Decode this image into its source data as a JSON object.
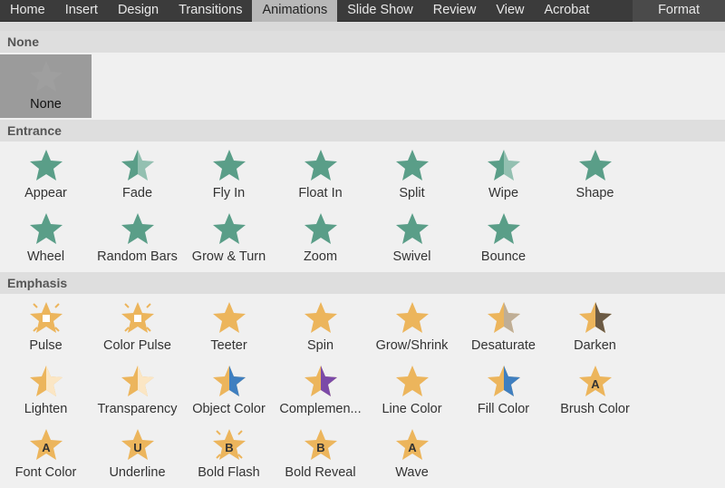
{
  "tabs": [
    "Home",
    "Insert",
    "Design",
    "Transitions",
    "Animations",
    "Slide Show",
    "Review",
    "View",
    "Acrobat",
    "Format"
  ],
  "active_tab": "Animations",
  "colors": {
    "entrance": "#5a9e88",
    "emphasis": "#ecb55c",
    "none": "#a3a3a3"
  },
  "sections": [
    {
      "title": "None",
      "kind": "none",
      "items": [
        {
          "label": "None",
          "icon": "star-outline-icon"
        }
      ]
    },
    {
      "title": "Entrance",
      "kind": "entrance",
      "items": [
        {
          "label": "Appear",
          "icon": "appear-icon"
        },
        {
          "label": "Fade",
          "icon": "fade-icon"
        },
        {
          "label": "Fly In",
          "icon": "fly-in-icon"
        },
        {
          "label": "Float In",
          "icon": "float-in-icon"
        },
        {
          "label": "Split",
          "icon": "split-icon"
        },
        {
          "label": "Wipe",
          "icon": "wipe-icon"
        },
        {
          "label": "Shape",
          "icon": "shape-icon"
        },
        {
          "label": "Wheel",
          "icon": "wheel-icon"
        },
        {
          "label": "Random Bars",
          "icon": "random-bars-icon"
        },
        {
          "label": "Grow & Turn",
          "icon": "grow-turn-icon"
        },
        {
          "label": "Zoom",
          "icon": "zoom-icon"
        },
        {
          "label": "Swivel",
          "icon": "swivel-icon"
        },
        {
          "label": "Bounce",
          "icon": "bounce-icon"
        }
      ]
    },
    {
      "title": "Emphasis",
      "kind": "emphasis",
      "items": [
        {
          "label": "Pulse",
          "icon": "pulse-icon"
        },
        {
          "label": "Color Pulse",
          "icon": "color-pulse-icon"
        },
        {
          "label": "Teeter",
          "icon": "teeter-icon"
        },
        {
          "label": "Spin",
          "icon": "spin-icon"
        },
        {
          "label": "Grow/Shrink",
          "icon": "grow-shrink-icon"
        },
        {
          "label": "Desaturate",
          "icon": "desaturate-icon"
        },
        {
          "label": "Darken",
          "icon": "darken-icon"
        },
        {
          "label": "Lighten",
          "icon": "lighten-icon"
        },
        {
          "label": "Transparency",
          "icon": "transparency-icon"
        },
        {
          "label": "Object Color",
          "icon": "object-color-icon",
          "half": "#3f7fc0"
        },
        {
          "label": "Complemen...",
          "icon": "complementary-color-icon",
          "half": "#7b4aa8"
        },
        {
          "label": "Line Color",
          "icon": "line-color-icon"
        },
        {
          "label": "Fill Color",
          "icon": "fill-color-icon",
          "half": "#3f7fc0"
        },
        {
          "label": "Brush Color",
          "icon": "brush-color-icon",
          "letter": "A"
        },
        {
          "label": "Font Color",
          "icon": "font-color-icon",
          "letter": "A"
        },
        {
          "label": "Underline",
          "icon": "underline-icon",
          "letter": "U"
        },
        {
          "label": "Bold Flash",
          "icon": "bold-flash-icon",
          "letter": "B"
        },
        {
          "label": "Bold Reveal",
          "icon": "bold-reveal-icon",
          "letter": "B"
        },
        {
          "label": "Wave",
          "icon": "wave-icon",
          "letter": "A"
        }
      ]
    }
  ]
}
